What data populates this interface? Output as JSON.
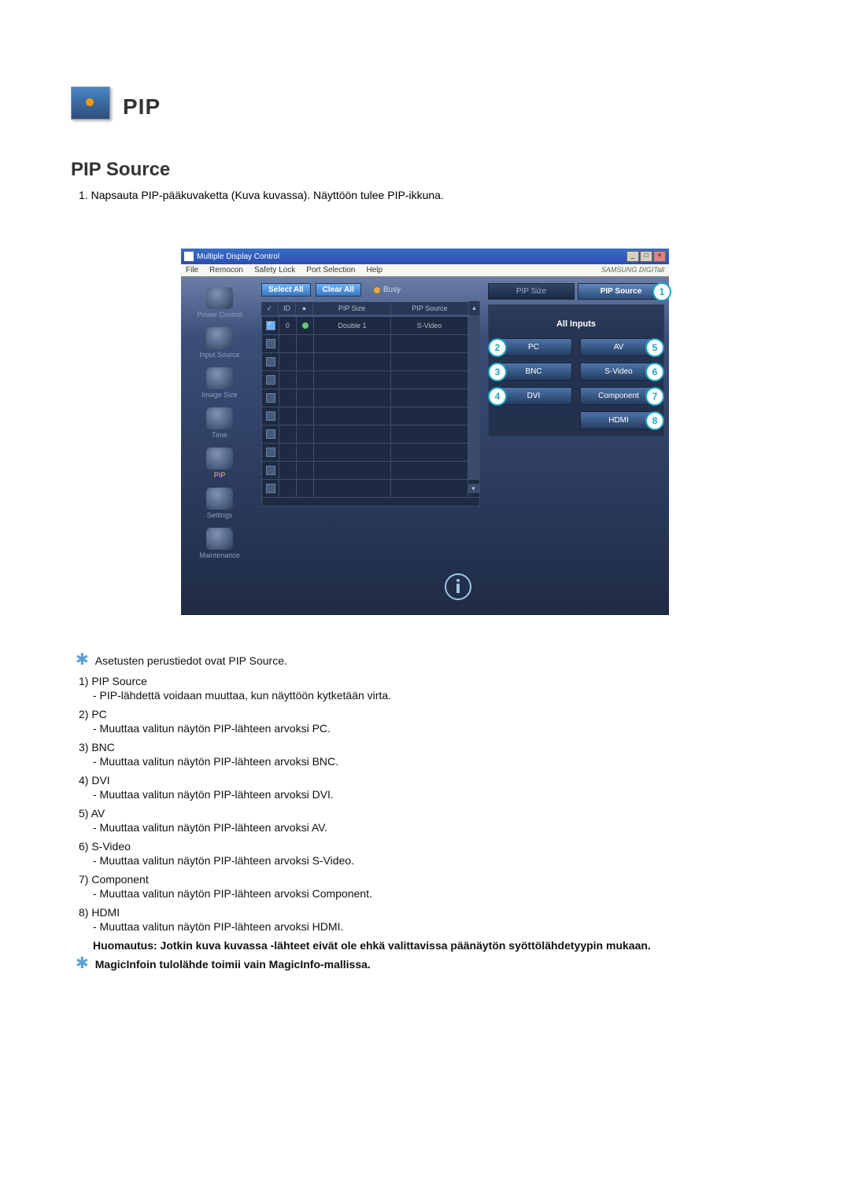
{
  "header": {
    "title": "PIP",
    "section": "PIP Source",
    "intro_num": "1.",
    "intro": "Napsauta PIP-pääkuvaketta (Kuva kuvassa). Näyttöön tulee PIP-ikkuna."
  },
  "window": {
    "title": "Multiple Display Control",
    "win_min": "_",
    "win_max": "□",
    "win_close": "×",
    "menu": [
      "File",
      "Remocon",
      "Safety Lock",
      "Port Selection",
      "Help"
    ],
    "brand": "SAMSUNG DIGITall"
  },
  "sidebar": {
    "items": [
      {
        "label": "Power Control"
      },
      {
        "label": "Input Source"
      },
      {
        "label": "Image Size"
      },
      {
        "label": "Time"
      },
      {
        "label": "PIP"
      },
      {
        "label": "Settings"
      },
      {
        "label": "Maintenance"
      }
    ]
  },
  "toolbar": {
    "select_all": "Select All",
    "clear_all": "Clear All",
    "busy": "Busy"
  },
  "grid": {
    "headers": {
      "chk": "✓",
      "id": "ID",
      "status": "●",
      "col1": "PIP Size",
      "col2": "PIP Source"
    },
    "row": {
      "id": "0",
      "col1": "Double 1",
      "col2": "S-Video"
    }
  },
  "right": {
    "tab_left": "PIP Size",
    "tab_right": "PIP Source",
    "panel_title": "All Inputs",
    "buttons": {
      "pc": {
        "label": "PC",
        "num": "2"
      },
      "bnc": {
        "label": "BNC",
        "num": "3"
      },
      "dvi": {
        "label": "DVI",
        "num": "4"
      },
      "av": {
        "label": "AV",
        "num": "5"
      },
      "svideo": {
        "label": "S-Video",
        "num": "6"
      },
      "component": {
        "label": "Component",
        "num": "7"
      },
      "hdmi": {
        "label": "HDMI",
        "num": "8"
      }
    },
    "tab_active_num": "1"
  },
  "notes": {
    "star1": "Asetusten perustiedot ovat PIP Source.",
    "items": [
      {
        "n": "1)",
        "t": "PIP Source",
        "d": "- PIP-lähdettä voidaan muuttaa, kun näyttöön kytketään virta."
      },
      {
        "n": "2)",
        "t": "PC",
        "d": "- Muuttaa valitun näytön PIP-lähteen arvoksi PC."
      },
      {
        "n": "3)",
        "t": "BNC",
        "d": "- Muuttaa valitun näytön PIP-lähteen arvoksi BNC."
      },
      {
        "n": "4)",
        "t": "DVI",
        "d": "- Muuttaa valitun näytön PIP-lähteen arvoksi DVI."
      },
      {
        "n": "5)",
        "t": "AV",
        "d": "- Muuttaa valitun näytön PIP-lähteen arvoksi AV."
      },
      {
        "n": "6)",
        "t": "S-Video",
        "d": "- Muuttaa valitun näytön PIP-lähteen arvoksi S-Video."
      },
      {
        "n": "7)",
        "t": "Component",
        "d": "- Muuttaa valitun näytön PIP-lähteen arvoksi Component."
      },
      {
        "n": "8)",
        "t": "HDMI",
        "d": "- Muuttaa valitun näytön PIP-lähteen arvoksi HDMI."
      }
    ],
    "caution": "Huomautus: Jotkin kuva kuvassa -lähteet eivät ole ehkä valittavissa päänäytön syöttölähdetyypin mukaan.",
    "star2": "MagicInfoin tulolähde toimii vain MagicInfo-mallissa."
  }
}
